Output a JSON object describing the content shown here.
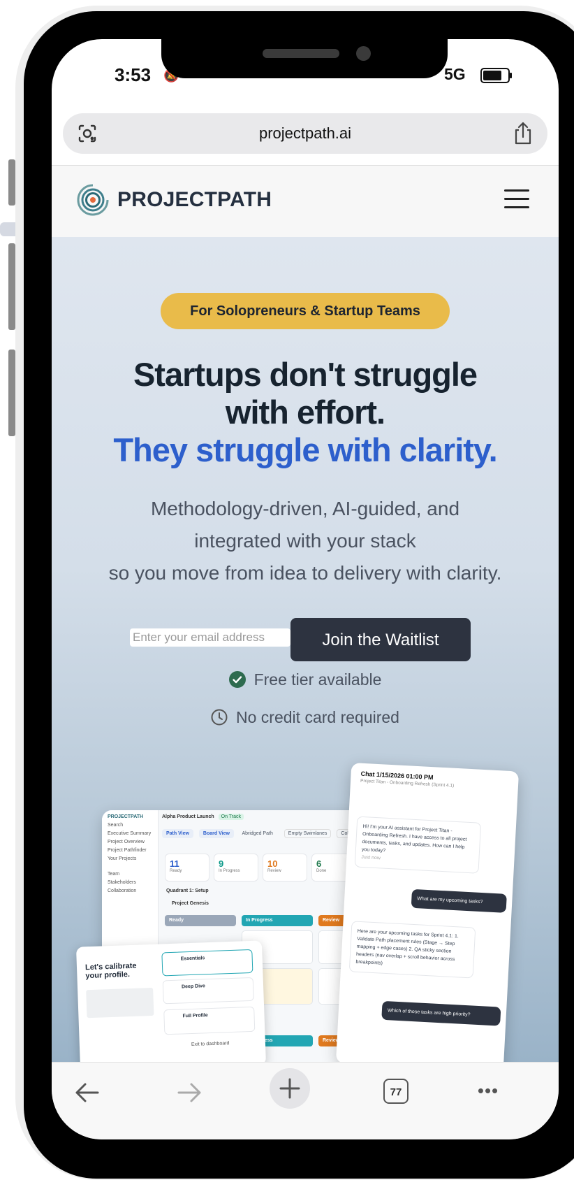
{
  "status_bar": {
    "time": "3:53",
    "network": "5G"
  },
  "browser": {
    "url": "projectpath.ai"
  },
  "site_header": {
    "brand": "PROJECTPATH"
  },
  "hero": {
    "badge": "For Solopreneurs & Startup Teams",
    "headline_line1": "Startups don't struggle",
    "headline_line2": "with effort.",
    "headline_accent": "They struggle with clarity.",
    "sub_line1": "Methodology-driven, AI-guided, and",
    "sub_line2": "integrated with your stack",
    "sub_line3": "so you move from idea to delivery with clarity.",
    "email_placeholder": "Enter your email address",
    "cta": "Join the Waitlist",
    "benefit1": "Free tier available",
    "benefit2": "No credit card required"
  },
  "mockup": {
    "app_name": "PROJECTPATH",
    "project_title": "Alpha Product Launch",
    "project_status": "On Track",
    "sidebar": [
      "Search",
      "Executive Summary",
      "Project Overview",
      "Project Pathfinder",
      "Your Projects",
      "Team",
      "Stakeholders",
      "Collaboration"
    ],
    "view_tabs": [
      "Path View",
      "Board View",
      "Abridged Path",
      "Empty Swimlanes",
      "Collapse"
    ],
    "stats": [
      {
        "value": "11",
        "label": "Ready"
      },
      {
        "value": "9",
        "label": "In Progress"
      },
      {
        "value": "10",
        "label": "Review"
      },
      {
        "value": "6",
        "label": "Done"
      }
    ],
    "quadrant": "Quadrant 1: Setup",
    "project_row": "Project Genesis",
    "columns": [
      "Ready",
      "In Progress",
      "Review"
    ],
    "calibrate_title": "Let's calibrate your profile.",
    "calibrate_options": [
      "Essentials",
      "Deep Dive",
      "Full Profile"
    ],
    "calibrate_exit": "Exit to dashboard",
    "chat_title": "Chat 1/15/2026 01:00 PM",
    "chat_subtitle": "Project Titan - Onboarding Refresh (Sprint 4.1)",
    "chat_messages": [
      {
        "from": "ai",
        "text": "Hi! I'm your AI assistant for Project Titan - Onboarding Refresh. I have access to all project documents, tasks, and updates. How can I help you today?"
      },
      {
        "from": "me",
        "text": "What are my upcoming tasks?"
      },
      {
        "from": "ai",
        "text": "Here are your upcoming tasks for Sprint 4.1: 1. Validate Path placement rules (Stage → Step mapping + edge cases) 2. QA sticky section headers (nav overlap + scroll behavior across breakpoints)"
      },
      {
        "from": "me",
        "text": "Which of those tasks are high priority?"
      }
    ],
    "chat_time": "Just now"
  },
  "toolbar": {
    "tab_count": "77"
  },
  "colors": {
    "accent": "#2d5fcc",
    "badge": "#e9bb4a",
    "cta": "#2d3340",
    "check": "#2e6b4f"
  }
}
